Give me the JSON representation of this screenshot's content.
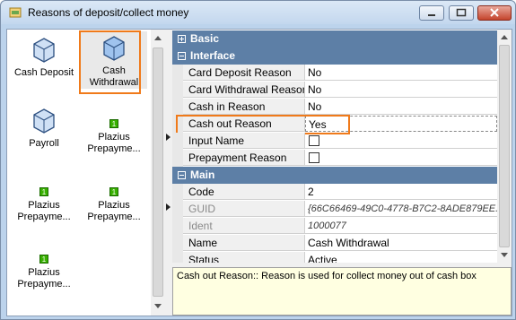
{
  "window": {
    "title": "Reasons of deposit/collect money"
  },
  "items": [
    {
      "label": "Cash Deposit",
      "icon": "cube-icon"
    },
    {
      "label": "Cash Withdrawal",
      "icon": "cube-icon",
      "selected": true
    },
    {
      "label": "Payroll",
      "icon": "cube-icon"
    },
    {
      "label": "Plazius Prepayme...",
      "icon": "plazius-icon",
      "badge": "1"
    },
    {
      "label": "Plazius Prepayme...",
      "icon": "plazius-icon",
      "badge": "1"
    },
    {
      "label": "Plazius Prepayme...",
      "icon": "plazius-icon",
      "badge": "1"
    },
    {
      "label": "Plazius Prepayme...",
      "icon": "plazius-icon",
      "badge": "1"
    }
  ],
  "grid": {
    "categories": {
      "basic": "Basic",
      "interface": "Interface",
      "main": "Main"
    },
    "interface_rows": [
      {
        "name": "Card Deposit Reason",
        "value": "No"
      },
      {
        "name": "Card Withdrawal Reason",
        "value": "No"
      },
      {
        "name": "Cash in Reason",
        "value": "No"
      },
      {
        "name": "Cash out Reason",
        "value": "Yes"
      }
    ],
    "checkbox_rows": [
      {
        "name": "Input Name",
        "checked": false
      },
      {
        "name": "Prepayment Reason",
        "checked": false
      }
    ],
    "main_rows": [
      {
        "name": "Code",
        "value": "2"
      },
      {
        "name": "GUID",
        "value": "{66C66469-49C0-4778-B7C2-8ADE879EE..."
      },
      {
        "name": "Ident",
        "value": "1000077"
      },
      {
        "name": "Name",
        "value": "Cash Withdrawal"
      },
      {
        "name": "Status",
        "value": "Active"
      }
    ]
  },
  "description": "Cash out Reason:: Reason is used for collect money out of cash box",
  "colors": {
    "highlight": "#f07a1a",
    "category": "#5d7fa6",
    "description_bg": "#ffffe1"
  }
}
